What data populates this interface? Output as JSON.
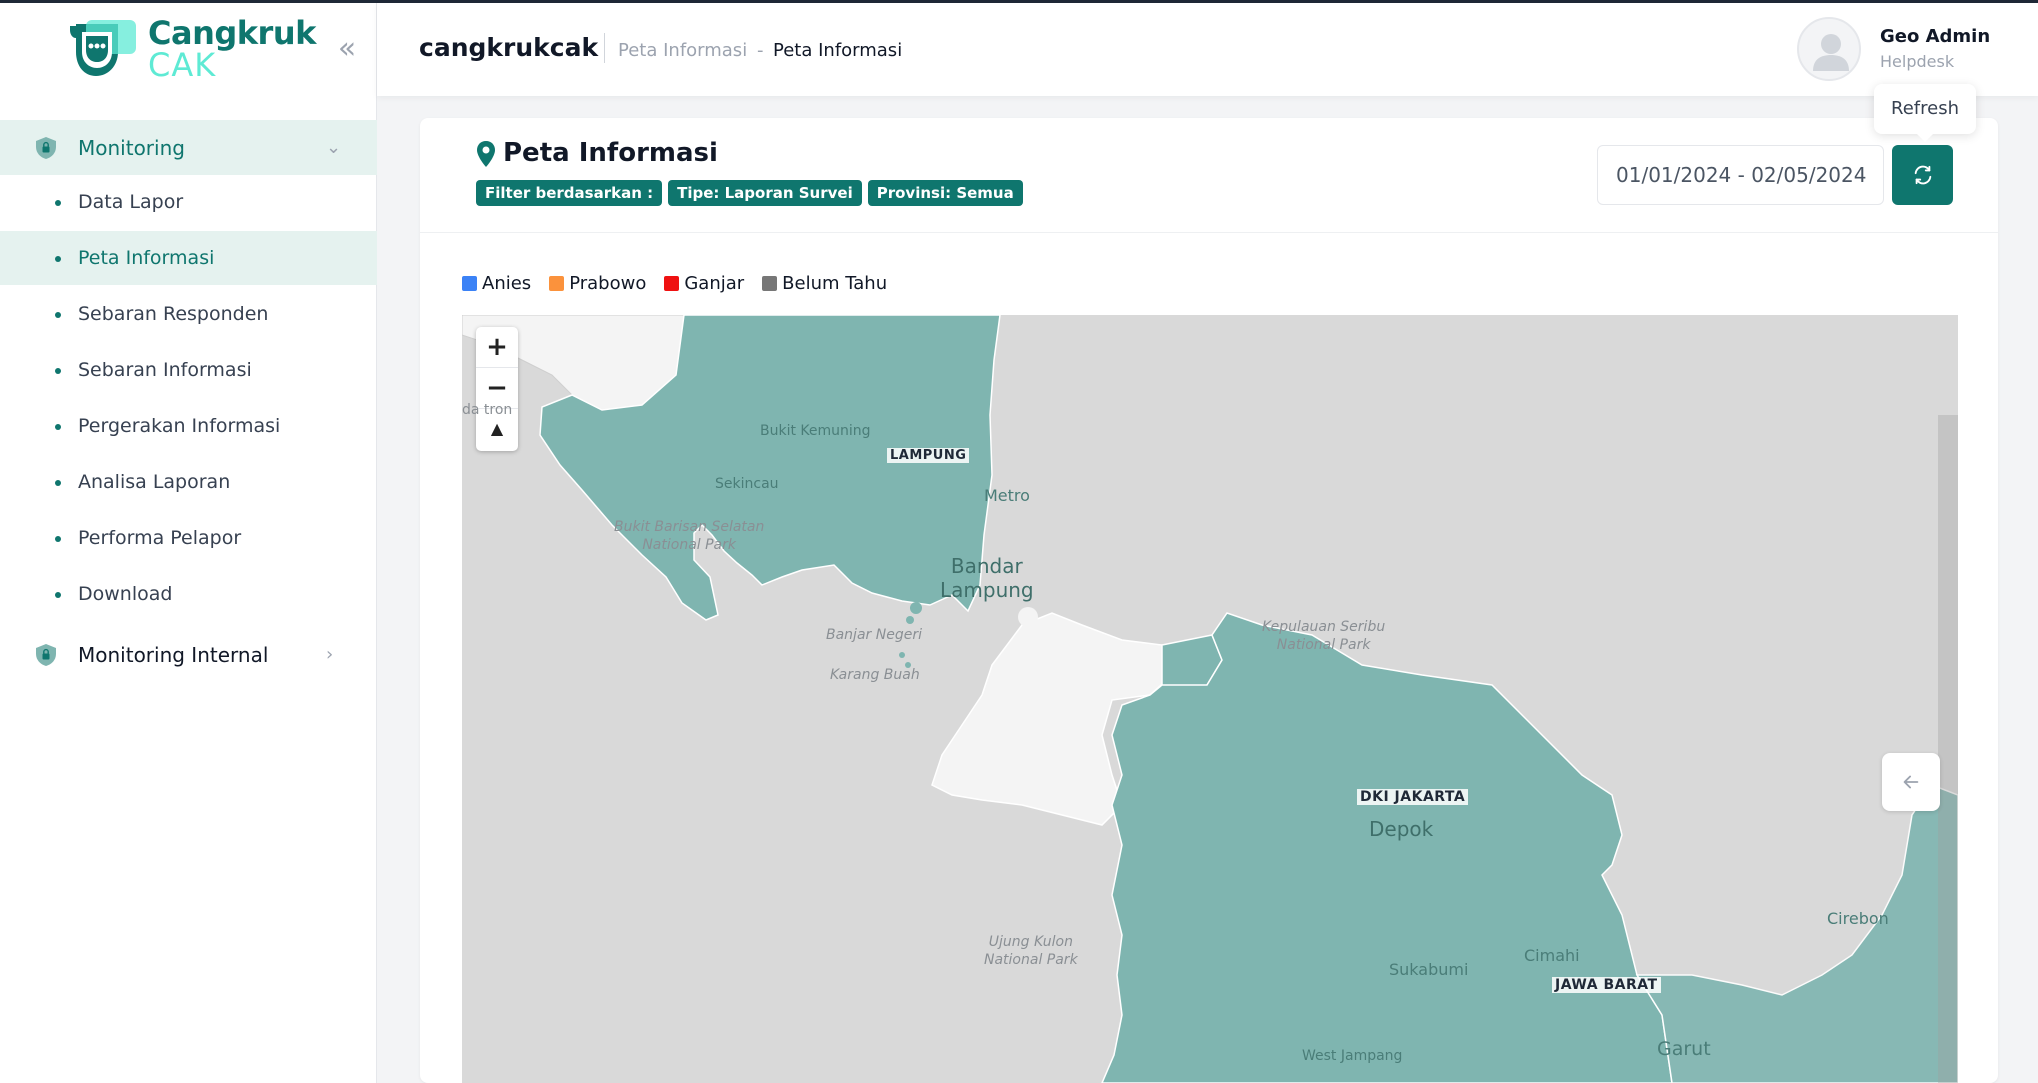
{
  "brand": {
    "line1": "Cangkruk",
    "line2": "CAK"
  },
  "sidebar": {
    "groups": [
      {
        "label": "Monitoring",
        "expanded": true
      },
      {
        "label": "Monitoring Internal",
        "expanded": false
      }
    ],
    "items": [
      {
        "label": "Data Lapor"
      },
      {
        "label": "Peta Informasi"
      },
      {
        "label": "Sebaran Responden"
      },
      {
        "label": "Sebaran Informasi"
      },
      {
        "label": "Pergerakan Informasi"
      },
      {
        "label": "Analisa Laporan"
      },
      {
        "label": "Performa Pelapor"
      },
      {
        "label": "Download"
      }
    ]
  },
  "header": {
    "app_name": "cangkrukcak",
    "breadcrumb": [
      "Peta Informasi",
      "-",
      "Peta Informasi"
    ],
    "user": {
      "name": "Geo Admin",
      "role": "Helpdesk"
    },
    "tooltip": "Refresh"
  },
  "page": {
    "title": "Peta Informasi",
    "badges": [
      "Filter berdasarkan :",
      "Tipe: Laporan Survei",
      "Provinsi: Semua"
    ],
    "date_range": "01/01/2024 - 02/05/2024"
  },
  "legend": [
    {
      "label": "Anies",
      "color": "#3b82f6"
    },
    {
      "label": "Prabowo",
      "color": "#fb923c"
    },
    {
      "label": "Ganjar",
      "color": "#ef1111"
    },
    {
      "label": "Belum Tahu",
      "color": "#777777"
    }
  ],
  "map": {
    "labels": {
      "lampung": "LAMPUNG",
      "dki": "DKI JAKARTA",
      "jabar": "JAWA BARAT",
      "bukit_kemuning": "Bukit Kemuning",
      "sekincau": "Sekincau",
      "metro": "Metro",
      "bandar_lampung_1": "Bandar",
      "bandar_lampung_2": "Lampung",
      "bukit_barisan_1": "Bukit Barisan Selatan",
      "bukit_barisan_2": "National Park",
      "banjar_negeri": "Banjar Negeri",
      "karang_buah": "Karang Buah",
      "kep_seribu_1": "Kepulauan Seribu",
      "kep_seribu_2": "National Park",
      "depok": "Depok",
      "ujung_kulon_1": "Ujung Kulon",
      "ujung_kulon_2": "National Park",
      "sukabumi": "Sukabumi",
      "cimahi": "Cimahi",
      "cirebon": "Cirebon",
      "garut": "Garut",
      "west_jampang": "West Jampang",
      "edge_tron": "da   tron"
    },
    "region_color": "#7fb5b0",
    "water_color": "#d9d9d9",
    "unfilled_color": "#f4f4f4"
  }
}
